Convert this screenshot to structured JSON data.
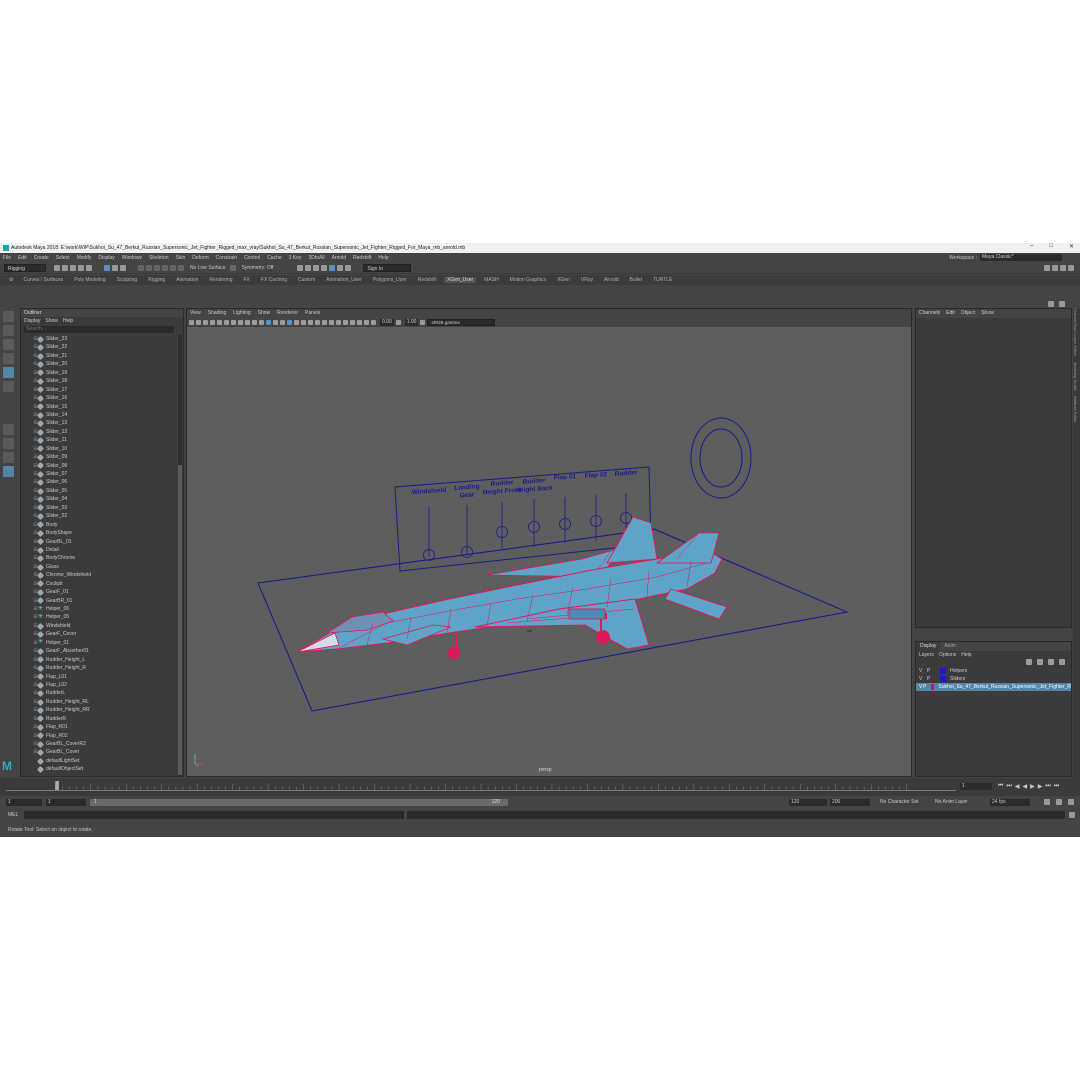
{
  "titlebar": {
    "title": "Autodesk Maya 2018: E:\\work\\WIP\\Sukhoi_Su_47_Berkut_Russian_Supersonic_Jet_Fighter_Rigged_max_vray\\Sukhoi_Su_47_Berkut_Russian_Supersonic_Jet_Fighter_Rigged_For_Maya_mb_arnold.mb"
  },
  "menubar": {
    "items": [
      "File",
      "Edit",
      "Create",
      "Select",
      "Modify",
      "Display",
      "Windows",
      "Skeleton",
      "Skin",
      "Deform",
      "Constrain",
      "Control",
      "Cache",
      "3 Key",
      "3DtoAll",
      "Arnold",
      "Redshift",
      "Help"
    ],
    "workspace_label": "Workspace :",
    "workspace_value": "Maya Classic*"
  },
  "statusline": {
    "menuset": "Rigging",
    "live_surface": "No Live Surface",
    "symmetry": "Symmetry: Off",
    "sign_in": "Sign In"
  },
  "shelf_tabs": [
    "Curves / Surfaces",
    "Poly Modeling",
    "Sculpting",
    "Rigging",
    "Animation",
    "Rendering",
    "FX",
    "FX Caching",
    "Custom",
    "Animation_User",
    "Polygons_User",
    "Redshift",
    "XGen_User",
    "MASH",
    "Motion Graphics",
    "XGen",
    "VRay",
    "Arnold",
    "Bullet",
    "TURTLE"
  ],
  "outliner": {
    "title": "Outliner",
    "menu": [
      "Display",
      "Show",
      "Help"
    ],
    "search_placeholder": "Search...",
    "items": [
      {
        "label": "Slider_23",
        "indent": 1,
        "icon": "transform"
      },
      {
        "label": "Slider_22",
        "indent": 1,
        "icon": "transform"
      },
      {
        "label": "Slider_21",
        "indent": 1,
        "icon": "transform"
      },
      {
        "label": "Slider_20",
        "indent": 1,
        "icon": "transform"
      },
      {
        "label": "Slider_19",
        "indent": 1,
        "icon": "transform"
      },
      {
        "label": "Slider_18",
        "indent": 1,
        "icon": "transform"
      },
      {
        "label": "Slider_17",
        "indent": 1,
        "icon": "transform"
      },
      {
        "label": "Slider_16",
        "indent": 1,
        "icon": "transform"
      },
      {
        "label": "Slider_15",
        "indent": 1,
        "icon": "transform"
      },
      {
        "label": "Slider_14",
        "indent": 1,
        "icon": "transform"
      },
      {
        "label": "Slider_13",
        "indent": 1,
        "icon": "transform"
      },
      {
        "label": "Slider_12",
        "indent": 1,
        "icon": "transform"
      },
      {
        "label": "Slider_11",
        "indent": 1,
        "icon": "transform"
      },
      {
        "label": "Slider_10",
        "indent": 1,
        "icon": "transform"
      },
      {
        "label": "Slider_09",
        "indent": 1,
        "icon": "transform"
      },
      {
        "label": "Slider_08",
        "indent": 1,
        "icon": "transform"
      },
      {
        "label": "Slider_07",
        "indent": 1,
        "icon": "transform"
      },
      {
        "label": "Slider_06",
        "indent": 1,
        "icon": "transform"
      },
      {
        "label": "Slider_05",
        "indent": 1,
        "icon": "transform"
      },
      {
        "label": "Slider_04",
        "indent": 1,
        "icon": "transform"
      },
      {
        "label": "Slider_03",
        "indent": 1,
        "icon": "transform"
      },
      {
        "label": "Slider_02",
        "indent": 1,
        "icon": "transform"
      },
      {
        "label": "Body",
        "indent": 0,
        "icon": "transform"
      },
      {
        "label": "BodyShape",
        "indent": 1,
        "icon": "transform"
      },
      {
        "label": "GearBL_01",
        "indent": 1,
        "icon": "transform"
      },
      {
        "label": "Detail",
        "indent": 1,
        "icon": "transform"
      },
      {
        "label": "BodyChrome",
        "indent": 1,
        "icon": "transform"
      },
      {
        "label": "Glass",
        "indent": 1,
        "icon": "transform"
      },
      {
        "label": "Chrome_Windshield",
        "indent": 1,
        "icon": "transform"
      },
      {
        "label": "Cockpit",
        "indent": 1,
        "icon": "transform"
      },
      {
        "label": "GearF_01",
        "indent": 1,
        "icon": "transform"
      },
      {
        "label": "GearBR_01",
        "indent": 1,
        "icon": "transform"
      },
      {
        "label": "Helper_06",
        "indent": 1,
        "icon": "locator"
      },
      {
        "label": "Helper_05",
        "indent": 1,
        "icon": "locator"
      },
      {
        "label": "Windshield",
        "indent": 1,
        "icon": "transform"
      },
      {
        "label": "GearF_Cover",
        "indent": 1,
        "icon": "transform"
      },
      {
        "label": "Helper_01",
        "indent": 1,
        "icon": "locator"
      },
      {
        "label": "GearF_Absorber01",
        "indent": 1,
        "icon": "transform"
      },
      {
        "label": "Rudder_Height_L",
        "indent": 1,
        "icon": "transform"
      },
      {
        "label": "Rudder_Height_R",
        "indent": 1,
        "icon": "transform"
      },
      {
        "label": "Flap_L01",
        "indent": 1,
        "icon": "transform"
      },
      {
        "label": "Flap_L02",
        "indent": 1,
        "icon": "transform"
      },
      {
        "label": "RudderL",
        "indent": 1,
        "icon": "transform"
      },
      {
        "label": "Rudder_Height_RL",
        "indent": 1,
        "icon": "transform"
      },
      {
        "label": "Rudder_Height_RR",
        "indent": 1,
        "icon": "transform"
      },
      {
        "label": "RudderR",
        "indent": 1,
        "icon": "transform"
      },
      {
        "label": "Flap_R01",
        "indent": 1,
        "icon": "transform"
      },
      {
        "label": "Flap_R02",
        "indent": 1,
        "icon": "transform"
      },
      {
        "label": "GearBL_CoverR2",
        "indent": 1,
        "icon": "transform"
      },
      {
        "label": "GearBL_Cover",
        "indent": 1,
        "icon": "transform"
      },
      {
        "label": "defaultLightSet",
        "indent": 0,
        "icon": "set"
      },
      {
        "label": "defaultObjectSet",
        "indent": 0,
        "icon": "set"
      }
    ]
  },
  "viewport": {
    "menu": [
      "View",
      "Shading",
      "Lighting",
      "Show",
      "Renderer",
      "Panels"
    ],
    "exposure": "0.00",
    "gamma": "1.00",
    "color_space": "sRGB gamma",
    "camera": "persp"
  },
  "control_board": {
    "labels": [
      {
        "id": "windshield",
        "lines": [
          "Windshield"
        ]
      },
      {
        "id": "landing-gear",
        "lines": [
          "Landing",
          "Gear"
        ]
      },
      {
        "id": "rudder-height-front",
        "lines": [
          "Rudder",
          "Height Front"
        ]
      },
      {
        "id": "rudder-height-back",
        "lines": [
          "Rudder",
          "Height Back"
        ]
      },
      {
        "id": "flap-01",
        "lines": [
          "Flap 01"
        ]
      },
      {
        "id": "flap-02",
        "lines": [
          "Flap 02"
        ]
      },
      {
        "id": "rudder",
        "lines": [
          "Rudder"
        ]
      }
    ]
  },
  "channel_box": {
    "menu": [
      "Channels",
      "Edit",
      "Object",
      "Show"
    ]
  },
  "layer_editor": {
    "tabs": [
      "Display",
      "Anim"
    ],
    "menu": [
      "Layers",
      "Options",
      "Help"
    ],
    "layers": [
      {
        "v": "V",
        "p": "P",
        "color": "#1a1ad6",
        "name": "Helpers",
        "selected": false
      },
      {
        "v": "V",
        "p": "P",
        "color": "#1a1ad6",
        "name": "Sliders",
        "selected": false
      },
      {
        "v": "V",
        "p": "P",
        "color": "#c2185b",
        "name": "Sukhoi_Su_47_Berkut_Russian_Supersonic_Jet_Fighter_R",
        "selected": true
      }
    ]
  },
  "side_tabs": [
    "Channel Box / Layer Editor",
    "Modeling Toolkit",
    "Attribute Editor"
  ],
  "timeline": {
    "current_frame": "1",
    "start": "1",
    "range_start": "1",
    "range_end_field": "120",
    "slider_end": "120",
    "end": "120",
    "max": "200",
    "character_set": "No Character Set",
    "anim_layer": "No Anim Layer",
    "fps": "24 fps"
  },
  "cmdline": {
    "lang": "MEL"
  },
  "helpline": {
    "text": "Rotate Tool: Select an object to rotate."
  },
  "colors": {
    "wire_red": "#e0185a",
    "surface_blue": "#5fa3c8",
    "board_blue": "#1c1c8c",
    "accent": "#5285a6"
  }
}
